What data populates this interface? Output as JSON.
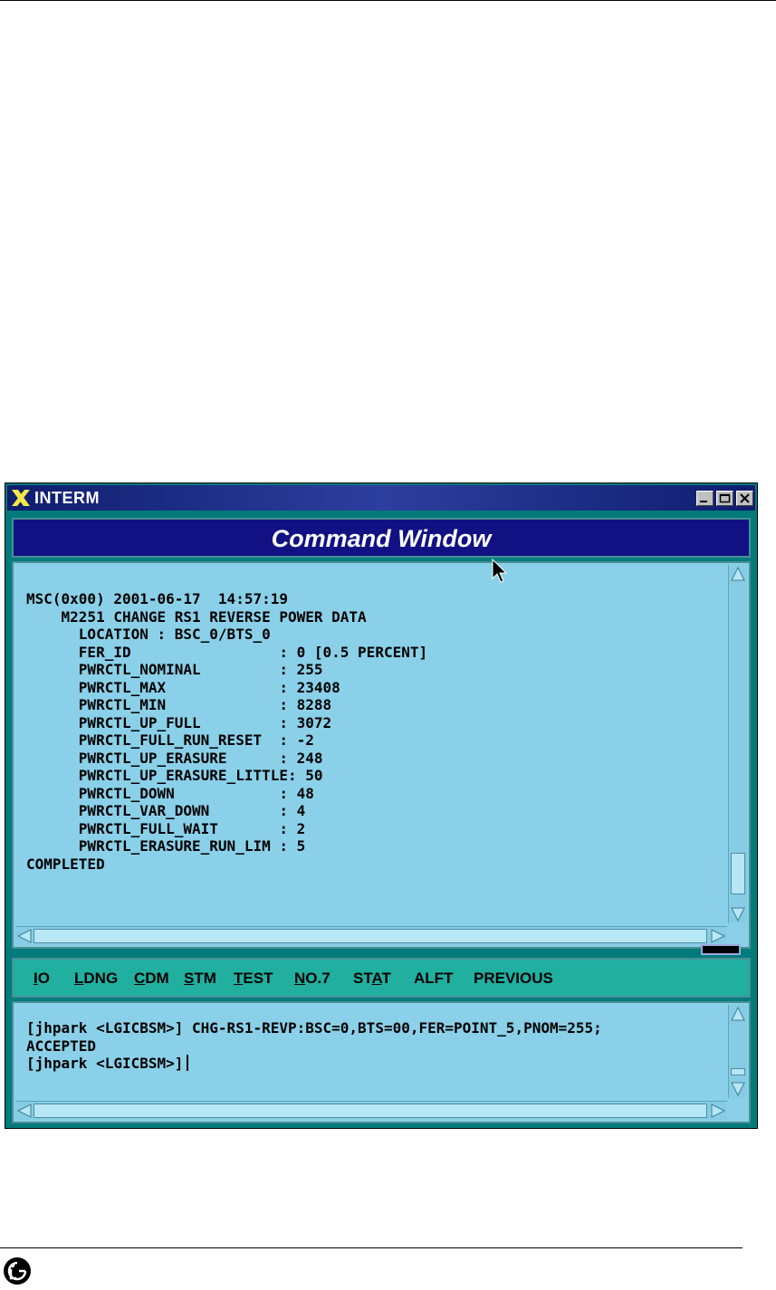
{
  "window": {
    "title": "INTERM",
    "header": "Command Window",
    "colors": {
      "titlebar": "#1a2a8a",
      "panel": "#8ad0e8",
      "menubar": "#21afa0",
      "window_bg": "#007b7b"
    }
  },
  "output": {
    "lines": [
      "MSC(0x00) 2001-06-17  14:57:19",
      "    M2251 CHANGE RS1 REVERSE POWER DATA",
      "      LOCATION : BSC_0/BTS_0",
      "      FER_ID                 : 0 [0.5 PERCENT]",
      "      PWRCTL_NOMINAL         : 255",
      "      PWRCTL_MAX             : 23408",
      "      PWRCTL_MIN             : 8288",
      "      PWRCTL_UP_FULL         : 3072",
      "      PWRCTL_FULL_RUN_RESET  : -2",
      "      PWRCTL_UP_ERASURE      : 248",
      "      PWRCTL_UP_ERASURE_LITTLE: 50",
      "      PWRCTL_DOWN            : 48",
      "      PWRCTL_VAR_DOWN        : 4",
      "      PWRCTL_FULL_WAIT       : 2",
      "      PWRCTL_ERASURE_RUN_LIM : 5",
      "COMPLETED"
    ]
  },
  "menu": {
    "items": [
      {
        "label": "IO",
        "mnemonic": "I"
      },
      {
        "label": "LDNG",
        "mnemonic": "L"
      },
      {
        "label": "CDM",
        "mnemonic": "C"
      },
      {
        "label": "STM",
        "mnemonic": "S"
      },
      {
        "label": "TEST",
        "mnemonic": "T"
      },
      {
        "label": "NO.7",
        "mnemonic": "N"
      },
      {
        "label": "STAT",
        "mnemonic": "A"
      },
      {
        "label": "ALFT",
        "mnemonic": ""
      },
      {
        "label": "PREVIOUS",
        "mnemonic": ""
      }
    ]
  },
  "input": {
    "lines": [
      "[jhpark <LGICBSM>] CHG-RS1-REVP:BSC=0,BTS=00,FER=POINT_5,PNOM=255;",
      "ACCEPTED"
    ],
    "prompt": "[jhpark <LGICBSM>]"
  }
}
